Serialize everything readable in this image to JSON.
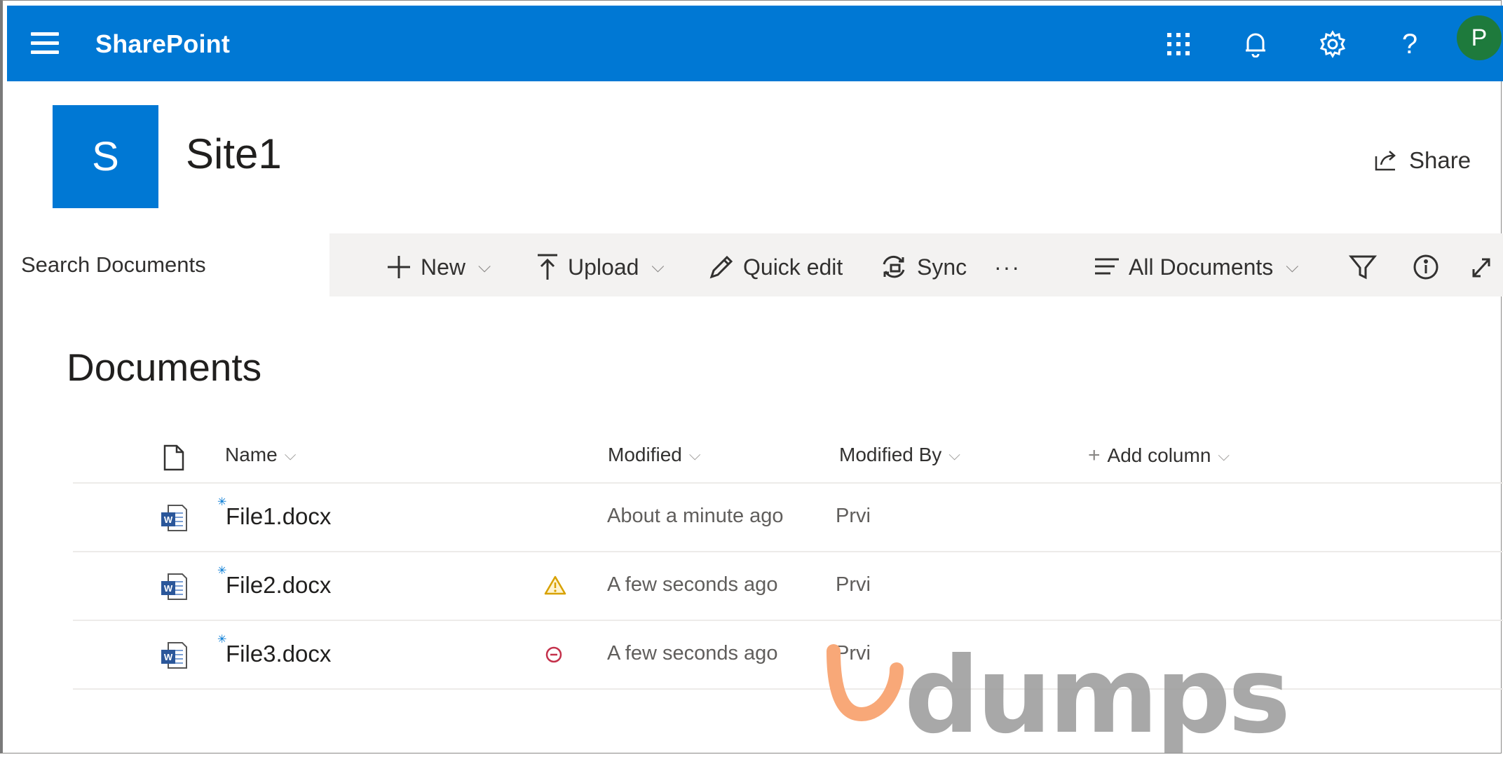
{
  "suite_bar": {
    "app_name": "SharePoint",
    "icons": [
      "app-launcher-icon",
      "bell-icon",
      "gear-icon",
      "help-icon"
    ],
    "help_label": "?",
    "user_initial": "P",
    "color": "#0078d4",
    "avatar_color": "#1e7a3c"
  },
  "site": {
    "logo_letter": "S",
    "title": "Site1",
    "share_label": "Share"
  },
  "command_bar": {
    "search_placeholder": "Search Documents",
    "new_label": "New",
    "upload_label": "Upload",
    "quick_edit_label": "Quick edit",
    "sync_label": "Sync",
    "more_label": "···",
    "view_label": "All Documents",
    "chevron": "⌵"
  },
  "library": {
    "title": "Documents",
    "columns": {
      "name": "Name",
      "modified": "Modified",
      "modified_by": "Modified By",
      "add_column": "Add column",
      "add_symbol": "+"
    },
    "rows": [
      {
        "name": "File1.docx",
        "status": "",
        "modified": "About a minute ago",
        "modified_by": "Prvi"
      },
      {
        "name": "File2.docx",
        "status": "warning-icon",
        "modified": "A few seconds ago",
        "modified_by": "Prvi"
      },
      {
        "name": "File3.docx",
        "status": "blocked-icon",
        "modified": "A few seconds ago",
        "modified_by": "Prvi"
      }
    ]
  },
  "watermark": {
    "text": "dumps",
    "accent": "#f8a878"
  }
}
